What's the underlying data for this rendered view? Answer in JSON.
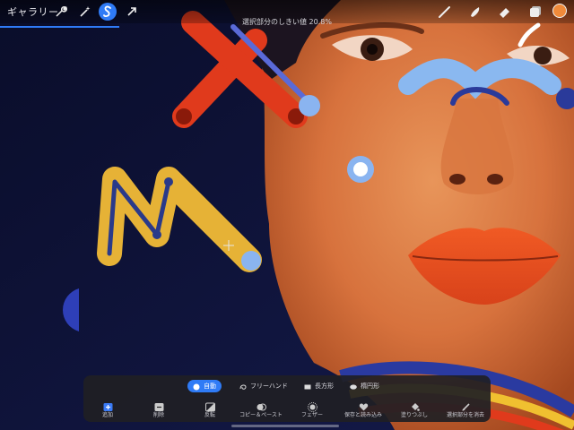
{
  "app": {
    "gallery_label": "ギャラリー",
    "status_text": "選択部分のしきい値 20.8%",
    "threshold_percent": 20.8,
    "accent_color": "#2f7bf6",
    "current_color": "#f08a3a"
  },
  "toolbar": {
    "left_tools": [
      {
        "name": "actions",
        "icon": "wrench-icon"
      },
      {
        "name": "adjustments",
        "icon": "magic-wand-icon"
      },
      {
        "name": "selection",
        "icon": "selection-s-icon",
        "active": true
      },
      {
        "name": "transform",
        "icon": "arrow-cursor-icon"
      }
    ],
    "right_tools": [
      {
        "name": "brush",
        "icon": "brush-icon"
      },
      {
        "name": "smudge",
        "icon": "smudge-icon"
      },
      {
        "name": "eraser",
        "icon": "eraser-icon"
      },
      {
        "name": "layers",
        "icon": "layers-icon"
      },
      {
        "name": "color",
        "icon": "color-swatch"
      }
    ]
  },
  "selection_panel": {
    "modes": [
      {
        "label": "自動",
        "icon": "dot-icon",
        "active": true
      },
      {
        "label": "フリーハンド",
        "icon": "lasso-icon",
        "active": false
      },
      {
        "label": "長方形",
        "icon": "rectangle-icon",
        "active": false
      },
      {
        "label": "楕円形",
        "icon": "ellipse-icon",
        "active": false
      }
    ],
    "actions": [
      {
        "label": "追加",
        "icon": "add-icon"
      },
      {
        "label": "削除",
        "icon": "remove-icon"
      },
      {
        "label": "反転",
        "icon": "invert-icon"
      },
      {
        "label": "コピー＆ペースト",
        "icon": "copy-paste-icon"
      },
      {
        "label": "フェザー",
        "icon": "feather-icon"
      },
      {
        "label": "保存と読み込み",
        "icon": "heart-icon"
      },
      {
        "label": "塗りつぶし",
        "icon": "fill-icon"
      },
      {
        "label": "選択部分を消去",
        "icon": "clear-selection-icon"
      }
    ]
  }
}
